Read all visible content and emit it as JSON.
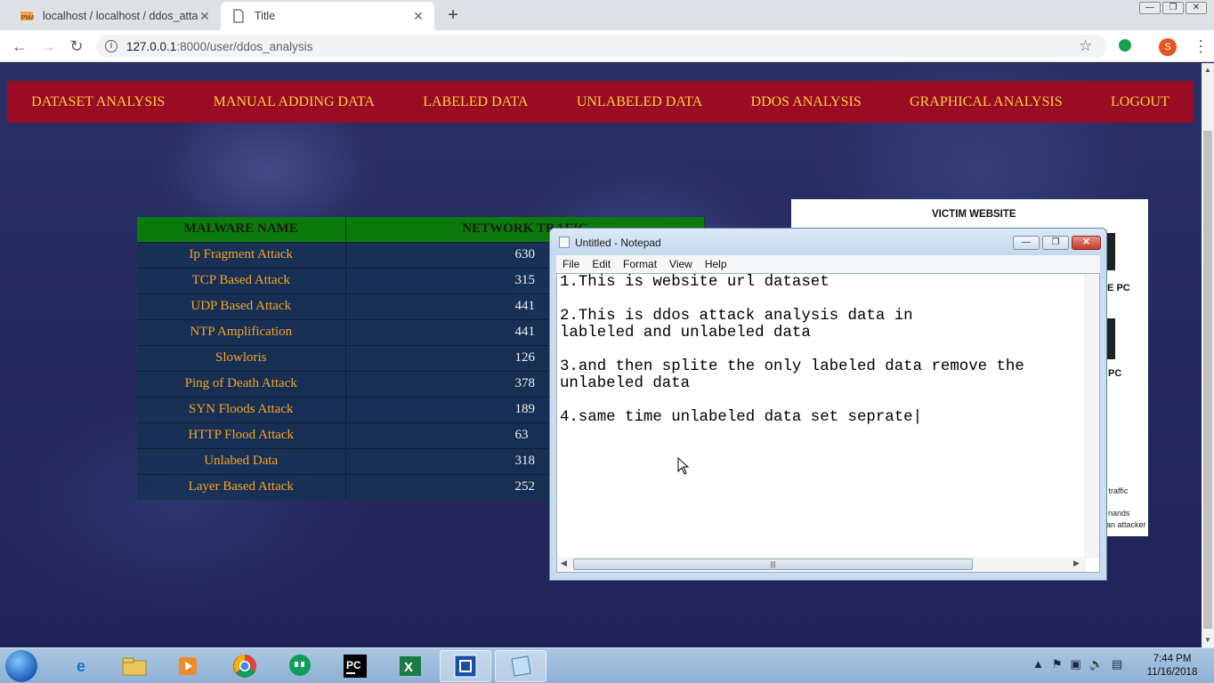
{
  "browser": {
    "tabs": [
      {
        "title": "localhost / localhost / ddos_attac",
        "active": false
      },
      {
        "title": "Title",
        "active": true
      }
    ],
    "url_host": "127.0.0.1",
    "url_path": ":8000/user/ddos_analysis",
    "avatar_letter": "S"
  },
  "nav": {
    "items": [
      "DATASET ANALYSIS",
      "MANUAL ADDING DATA",
      "LABELED DATA",
      "UNLABELED DATA",
      "DDOS ANALYSIS",
      "GRAPHICAL ANALYSIS",
      "LOGOUT"
    ]
  },
  "table": {
    "headers": [
      "MALWARE NAME",
      "NETWORK TRAFIC"
    ],
    "rows": [
      {
        "name": "Ip Fragment Attack",
        "count": "630"
      },
      {
        "name": "TCP Based Attack",
        "count": "315"
      },
      {
        "name": "UDP Based Attack",
        "count": "441"
      },
      {
        "name": "NTP Amplification",
        "count": "441"
      },
      {
        "name": "Slowloris",
        "count": "126"
      },
      {
        "name": "Ping of Death Attack",
        "count": "378"
      },
      {
        "name": "SYN Floods Attack",
        "count": "189"
      },
      {
        "name": "HTTP Flood Attack",
        "count": "63"
      },
      {
        "name": "Unlabed Data",
        "count": "318"
      },
      {
        "name": "Layer Based Attack",
        "count": "252"
      }
    ]
  },
  "victim_panel": {
    "title": "VICTIM WEBSITE",
    "label_1": "IE PC",
    "label_2": "PC",
    "note_1": "l traffic",
    "note_2": "nands",
    "note_3": "an attacker"
  },
  "notepad": {
    "title": "Untitled - Notepad",
    "menu": [
      "File",
      "Edit",
      "Format",
      "View",
      "Help"
    ],
    "text": "1.This is website url dataset\n\n2.This is ddos attack analysis data in\nlableled and unlabeled data\n\n3.and then splite the only labeled data remove the\nunlabeled data\n\n4.same time unlabeled data set seprate|"
  },
  "taskbar": {
    "time": "7:44 PM",
    "date": "11/16/2018"
  },
  "colors": {
    "nav_bg": "#9a0b24",
    "nav_text": "#f7d23a",
    "table_header": "#0a7a0a",
    "table_text": "#f4a422"
  }
}
